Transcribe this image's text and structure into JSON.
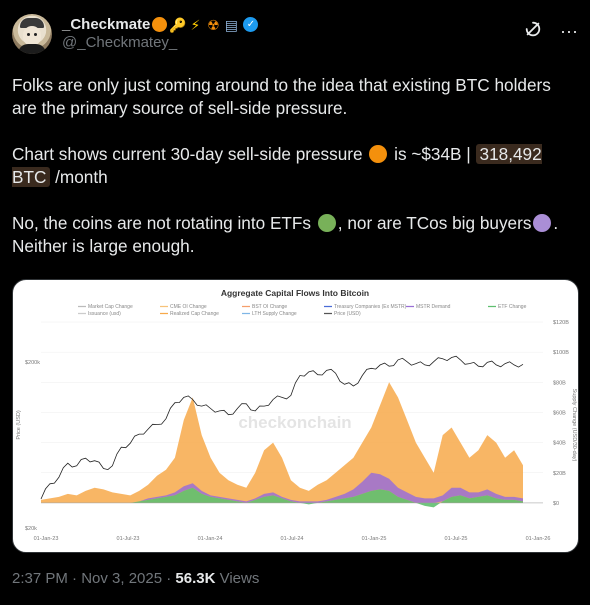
{
  "author": {
    "display_name": "_Checkmate",
    "handle": "@_Checkmatey_",
    "badges": [
      "orange-circle",
      "key",
      "lightning",
      "radioactive",
      "database",
      "verified"
    ]
  },
  "actions": {
    "grok_icon": "grok-icon",
    "more": "···"
  },
  "tweet": {
    "p1": "Folks are only just coming around to the idea that existing BTC holders are the primary source of sell-side pressure.",
    "p2_a": "Chart shows current 30-day sell-side pressure ",
    "p2_b": " is ~$34B | ",
    "p2_cash": "318,492 BTC",
    "p2_c": " /month",
    "p3_a": "No, the coins are not rotating into ETFs ",
    "p3_b": ", nor are TCos big buyers",
    "p3_c": ". Neither is large enough.",
    "dot_colors": {
      "orange": "#f4900c",
      "green": "#78b159",
      "purple": "#aa8ed6"
    }
  },
  "chart_data": {
    "type": "area",
    "title": "Aggregate Capital Flows Into Bitcoin",
    "watermark": "checkonchain",
    "ylabel_left": "Price (USD)",
    "ylabel_right": "Supply Change (USD/30-day)",
    "legend": [
      "Market Cap Change",
      "CME OI Change",
      "BST OI Change",
      "Treasury Companies (Ex MSTR)",
      "MSTR Demand",
      "ETF Change",
      "Issuance (usd)",
      "Realized Cap Change",
      "LTH Supply Change",
      "Price (USD)"
    ],
    "x_ticks": [
      "01-Jan-23",
      "01-Jul-23",
      "01-Jan-24",
      "01-Jul-24",
      "01-Jan-25",
      "01-Jul-25",
      "01-Jan-26"
    ],
    "y_left_ticks": [
      "$20k",
      "$200k"
    ],
    "y_right_ticks": [
      "$0",
      "$20B",
      "$40B",
      "$60B",
      "$80B",
      "$100B",
      "$120B"
    ],
    "series": [
      {
        "name": "Realized Cap Change",
        "color": "#f7a94a",
        "values": [
          2,
          3,
          4,
          6,
          5,
          8,
          10,
          9,
          7,
          6,
          5,
          8,
          12,
          18,
          22,
          30,
          55,
          70,
          45,
          30,
          20,
          15,
          12,
          10,
          20,
          35,
          40,
          30,
          15,
          10,
          8,
          12,
          15,
          20,
          25,
          30,
          40,
          50,
          65,
          80,
          70,
          55,
          40,
          30,
          20,
          45,
          50,
          40,
          30,
          35,
          45,
          40,
          30,
          35,
          25
        ]
      },
      {
        "name": "ETF Change",
        "color": "#5fbf6f",
        "values": [
          0,
          0,
          0,
          0,
          0,
          0,
          0,
          0,
          0,
          0,
          0,
          1,
          2,
          3,
          4,
          5,
          8,
          10,
          6,
          4,
          3,
          2,
          1,
          0,
          2,
          4,
          5,
          3,
          1,
          0,
          -1,
          0,
          1,
          2,
          3,
          4,
          6,
          8,
          9,
          8,
          4,
          2,
          0,
          -2,
          -3,
          1,
          4,
          5,
          3,
          4,
          5,
          3,
          2,
          2,
          1
        ]
      },
      {
        "name": "MSTR Demand",
        "color": "#9a6fd6",
        "values": [
          0,
          0,
          0,
          0,
          0,
          0,
          0,
          0,
          0,
          0,
          0,
          0,
          1,
          1,
          1,
          2,
          3,
          3,
          2,
          1,
          1,
          1,
          1,
          1,
          1,
          2,
          2,
          1,
          1,
          1,
          1,
          1,
          1,
          2,
          3,
          5,
          8,
          12,
          10,
          8,
          6,
          5,
          4,
          3,
          3,
          4,
          6,
          5,
          4,
          3,
          4,
          3,
          2,
          2,
          2
        ]
      }
    ],
    "price_usd": [
      17000,
      21000,
      23000,
      28000,
      27000,
      30000,
      29000,
      26000,
      27000,
      35000,
      37000,
      42000,
      45000,
      48000,
      52000,
      65000,
      70000,
      68000,
      62000,
      60000,
      58000,
      55000,
      60000,
      64000,
      58000,
      62000,
      68000,
      70000,
      72000,
      95000,
      100000,
      96000,
      102000,
      98000,
      84000,
      82000,
      95000,
      105000,
      110000,
      108000,
      118000,
      115000,
      112000,
      110000,
      115000,
      120000,
      122000,
      118000,
      112000,
      108000,
      114000,
      110000,
      112000,
      110000,
      111000
    ],
    "ylim_supply_usd_bn": [
      -10,
      120
    ],
    "ylim_price_usd": [
      15000,
      200000
    ]
  },
  "meta": {
    "time": "2:37 PM · Nov 3, 2025 · ",
    "views_count": "56.3K",
    "views_label": " Views"
  }
}
